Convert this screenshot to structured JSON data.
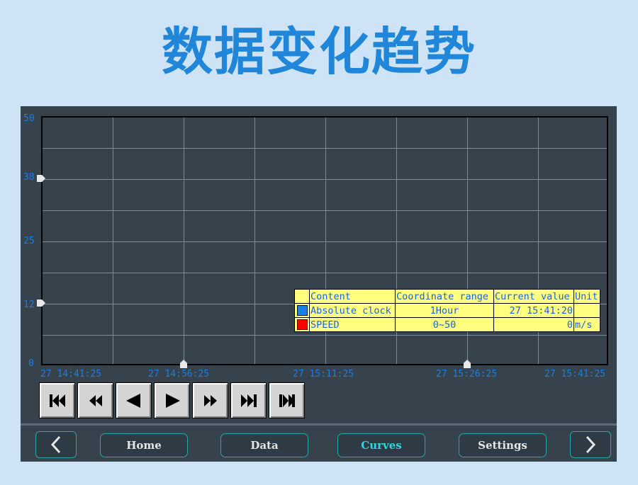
{
  "header": {
    "title": "数据变化趋势"
  },
  "chart": {
    "y_ticks": [
      "50",
      "38",
      "25",
      "12",
      "0"
    ],
    "x_ticks": [
      "27 14:41:25",
      "27 14:56:25",
      "27 15:11:25",
      "27 15:26:25",
      "27 15:41:25"
    ],
    "grid": true
  },
  "legend": {
    "headers": [
      "Content",
      "Coordinate range",
      "Current value",
      "Unit"
    ],
    "rows": [
      {
        "color": "#1a7fe6",
        "content": "Absolute clock",
        "range": "1Hour",
        "value": "27 15:41:20",
        "unit": ""
      },
      {
        "color": "#ff0000",
        "content": "SPEED",
        "range": "0~50",
        "value": "0",
        "unit": "m/s"
      }
    ]
  },
  "playback": {
    "buttons": [
      "skip-to-start",
      "fast-rewind",
      "step-back",
      "play",
      "fast-forward",
      "skip-to-end",
      "jump-to-latest"
    ]
  },
  "nav": {
    "home": "Home",
    "data": "Data",
    "curves": "Curves",
    "settings": "Settings",
    "active": "Curves"
  },
  "chart_data": {
    "type": "line",
    "title": "",
    "xlabel": "",
    "ylabel": "",
    "x_ticks": [
      "27 14:41:25",
      "27 14:56:25",
      "27 15:11:25",
      "27 15:26:25",
      "27 15:41:25"
    ],
    "ylim": [
      0,
      50
    ],
    "y_ticks": [
      0,
      12,
      25,
      38,
      50
    ],
    "grid": true,
    "series": [
      {
        "name": "SPEED",
        "color": "#ff0000",
        "values": []
      }
    ]
  }
}
